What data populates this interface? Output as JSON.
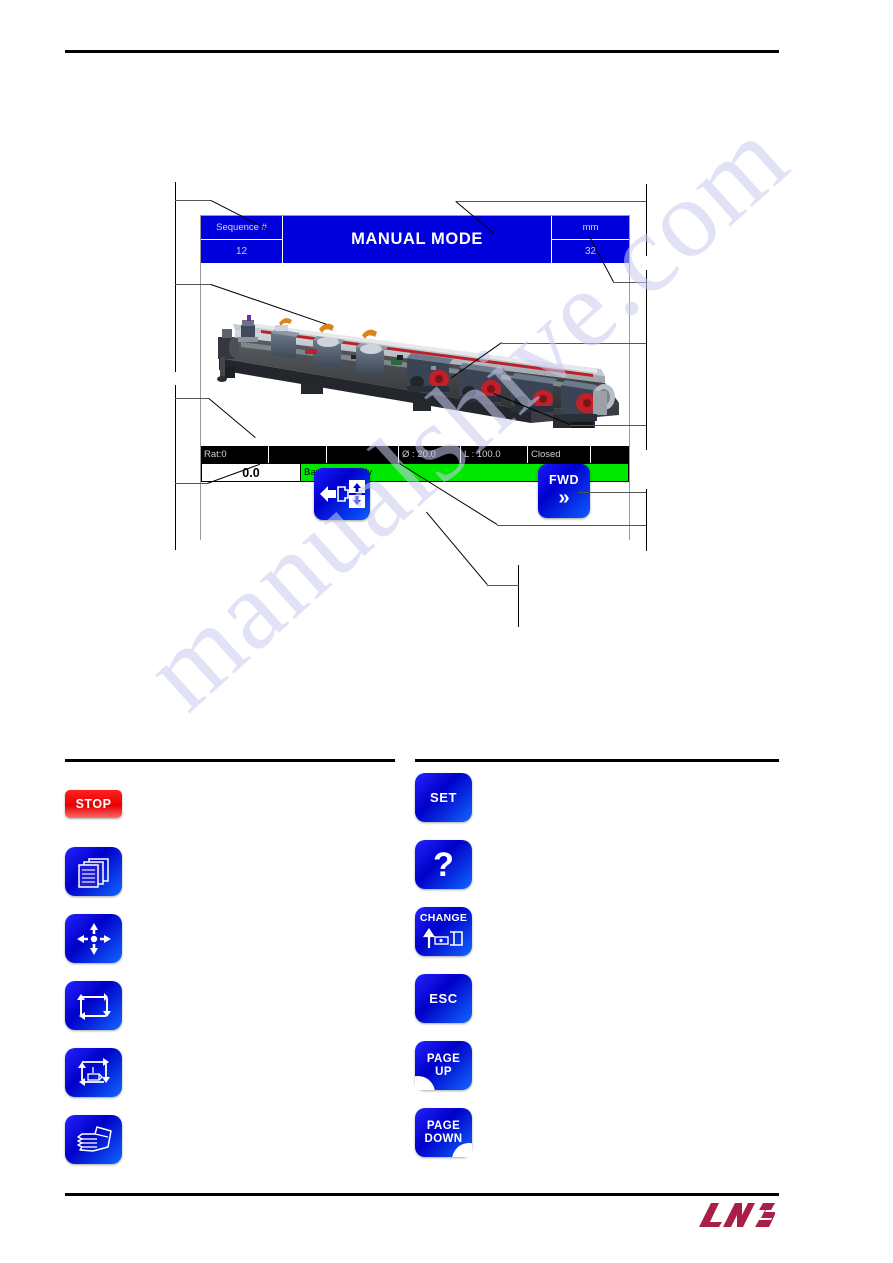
{
  "watermark": {
    "text": "manualshive.com"
  },
  "hmi": {
    "header": {
      "sequence_label": "Sequence #",
      "sequence_value": "12",
      "mode_title": "MANUAL MODE",
      "unit_label": "mm",
      "unit_value": "32"
    },
    "graphic": {
      "name": "barfeeder-machine-illustration"
    },
    "info_bar": [
      {
        "name": "ratio",
        "text": "Rat:0"
      },
      {
        "name": "field-2",
        "text": ""
      },
      {
        "name": "field-3",
        "text": ""
      },
      {
        "name": "diameter",
        "text": "Ø :  20.0"
      },
      {
        "name": "length",
        "text": "L :   100.0"
      },
      {
        "name": "cover-state",
        "text": "Closed"
      },
      {
        "name": "field-7",
        "text": ""
      }
    ],
    "status": {
      "counter_value": "0.0",
      "message": "Barfeeder ready",
      "message_color": "#00e800"
    },
    "softkeys": [
      {
        "name": "retract-button",
        "label": "",
        "icon": "retract-bar-icon"
      },
      {
        "name": "fwd-button",
        "label": "FWD",
        "chevron": "»",
        "icon": "double-chevron-right-icon"
      }
    ]
  },
  "legend_left": [
    {
      "name": "stop-key",
      "label": "STOP",
      "icon": "stop-icon"
    },
    {
      "name": "pages-key",
      "label": "",
      "icon": "stacked-pages-icon"
    },
    {
      "name": "centering-key",
      "label": "",
      "icon": "four-arrows-center-icon"
    },
    {
      "name": "loop-key",
      "label": "",
      "icon": "rectangular-cycle-arrows-icon"
    },
    {
      "name": "dimension-key",
      "label": "",
      "icon": "cycle-arrows-with-part-icon"
    },
    {
      "name": "manual-hand-key",
      "label": "",
      "icon": "hand-icon"
    }
  ],
  "legend_right": [
    {
      "name": "set-key",
      "label": "SET",
      "icon": "set-icon"
    },
    {
      "name": "help-key",
      "label": "?",
      "icon": "question-mark-icon"
    },
    {
      "name": "change-key",
      "label": "CHANGE",
      "icon": "bar-change-icon"
    },
    {
      "name": "esc-key",
      "label": "ESC",
      "icon": "escape-icon"
    },
    {
      "name": "page-up-key",
      "label_line1": "PAGE",
      "label_line2": "UP",
      "icon": "page-up-icon"
    },
    {
      "name": "page-down-key",
      "label_line1": "PAGE",
      "label_line2": "DOWN",
      "icon": "page-down-icon"
    }
  ],
  "branding": {
    "logo_text": "LNS",
    "logo_color": "#a81f47"
  }
}
